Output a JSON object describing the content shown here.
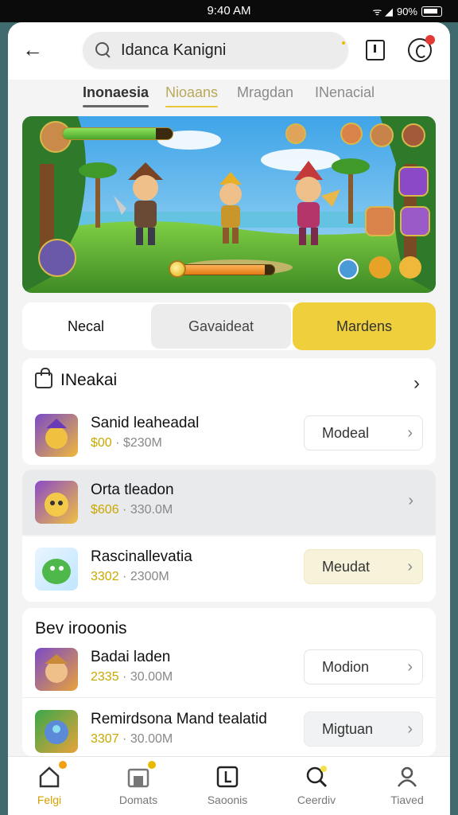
{
  "status": {
    "time": "9:40 AM",
    "battery": "90%"
  },
  "header": {
    "search_text": "Idanca Kanigni"
  },
  "tabs": [
    {
      "label": "Inonaesia"
    },
    {
      "label": "Nioaans"
    },
    {
      "label": "Mragdan"
    },
    {
      "label": "INenacial"
    }
  ],
  "banner": {
    "health_level": 0.85,
    "power_level": 0.9
  },
  "segments": [
    {
      "label": "Necal"
    },
    {
      "label": "Gavaideat"
    },
    {
      "label": "Mardens"
    }
  ],
  "section1": {
    "title": "INeakai",
    "items": [
      {
        "name": "Sanid leaheadal",
        "price": "$00",
        "sep": "·",
        "amount": "$230M",
        "button": "Modeal"
      },
      {
        "name": "Orta tleadon",
        "price": "$606",
        "sep": "·",
        "amount": "330.0M",
        "button": ""
      },
      {
        "name": "Rascinallevatia",
        "price": "3302",
        "sep": "·",
        "amount": "2300M",
        "button": "Meudat"
      }
    ]
  },
  "section2": {
    "title": "Bev irooonis",
    "items": [
      {
        "name": "Badai laden",
        "price": "2335",
        "sep": "·",
        "amount": "30.00M",
        "button": "Modion"
      },
      {
        "name": "Remirdsona Mand tealatid",
        "price": "3307",
        "sep": "·",
        "amount": "30.00M",
        "button": "Migtuan"
      }
    ]
  },
  "nav": [
    {
      "label": "Felgi"
    },
    {
      "label": "Domats"
    },
    {
      "label": "Saoonis"
    },
    {
      "label": "Ceerdiv"
    },
    {
      "label": "Tiaved"
    }
  ],
  "colors": {
    "accent": "#efcf3c",
    "active_nav": "#d8a100"
  }
}
